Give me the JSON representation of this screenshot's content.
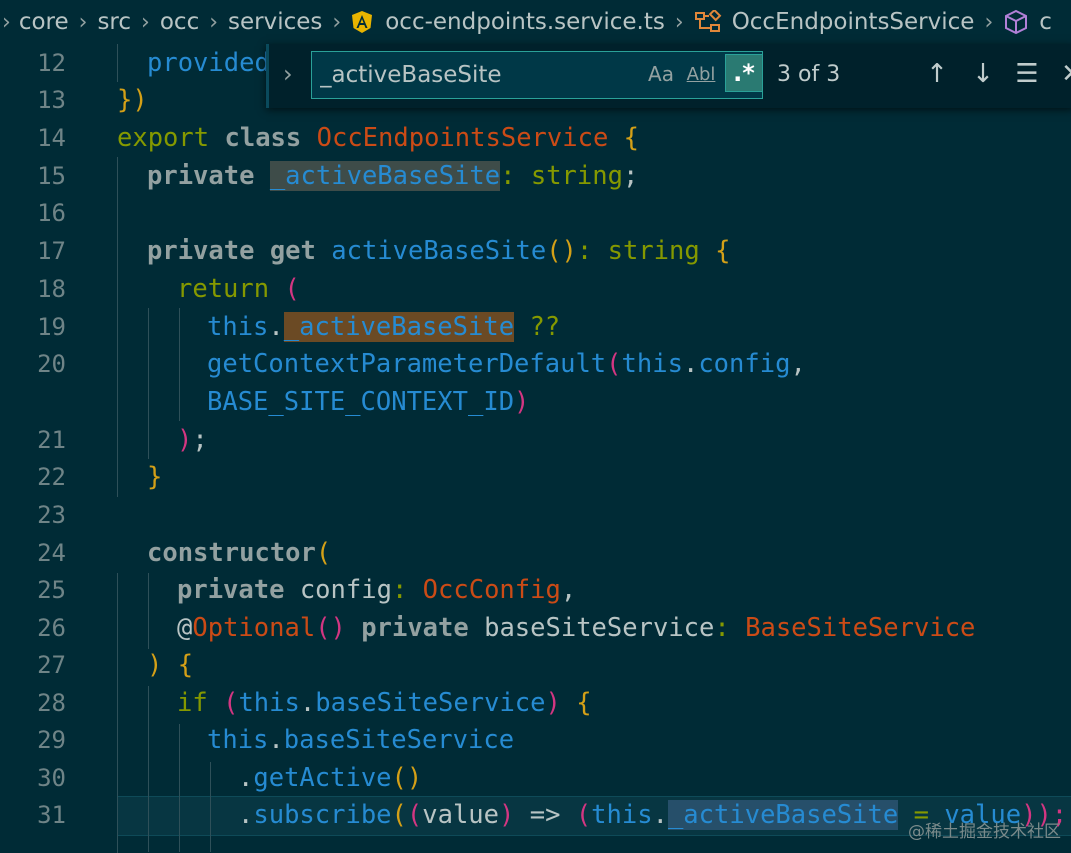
{
  "breadcrumb": {
    "items": [
      "core",
      "src",
      "occ",
      "services",
      "occ-endpoints.service.ts",
      "OccEndpointsService",
      "c"
    ],
    "icons": [
      "angular-icon",
      "class-icon",
      "method-cube-icon"
    ]
  },
  "find": {
    "query": "_activeBaseSite",
    "case_label": "Aa",
    "word_label": "Abl",
    "regex_label": ".*",
    "count": "3 of 3",
    "regex_enabled": true
  },
  "line_numbers": [
    "12",
    "13",
    "14",
    "15",
    "16",
    "17",
    "18",
    "19",
    "20",
    "",
    "21",
    "22",
    "23",
    "24",
    "25",
    "26",
    "27",
    "28",
    "29",
    "30",
    "31"
  ],
  "code": {
    "l12": "provided",
    "l13": "})",
    "l14_kw": "export",
    "l14_cls_kw": "class",
    "l14_name": "OccEndpointsService",
    "l14_brace": "{",
    "l15_kw": "private",
    "l15_id": "_activeBaseSite",
    "l15_colon": ":",
    "l15_type": "string",
    "l15_semi": ";",
    "l17_kw": "private get",
    "l17_fn": "activeBaseSite",
    "l17_paren": "()",
    "l17_colon": ":",
    "l17_type": "string",
    "l17_brace": "{",
    "l18_kw": "return",
    "l18_paren": "(",
    "l19_this": "this",
    "l19_dot": ".",
    "l19_id": "_activeBaseSite",
    "l19_op": "??",
    "l20_fn": "getContextParameterDefault",
    "l20_paren": "(",
    "l20_this": "this",
    "l20_dot": ".",
    "l20_prop": "config",
    "l20_comma": ",",
    "l20b_const": "BASE_SITE_CONTEXT_ID",
    "l20b_paren": ")",
    "l21_paren": ")",
    "l21_semi": ";",
    "l22": "}",
    "l24_kw": "constructor",
    "l24_paren": "(",
    "l25_kw": "private",
    "l25_id": "config",
    "l25_colon": ":",
    "l25_type": "OccConfig",
    "l25_comma": ",",
    "l26_at": "@",
    "l26_dec": "Optional",
    "l26_paren": "()",
    "l26_kw": "private",
    "l26_id": "baseSiteService",
    "l26_colon": ":",
    "l26_type": "BaseSiteService",
    "l27_paren": ")",
    "l27_brace": "{",
    "l28_kw": "if",
    "l28_paren": "(",
    "l28_this": "this",
    "l28_dot": ".",
    "l28_prop": "baseSiteService",
    "l28_close": ")",
    "l28_brace": "{",
    "l29_this": "this",
    "l29_dot": ".",
    "l29_prop": "baseSiteService",
    "l30_dot": ".",
    "l30_fn": "getActive",
    "l30_paren": "()",
    "l31_dot": ".",
    "l31_fn": "subscribe",
    "l31_p1": "(",
    "l31_p2": "(",
    "l31_arg": "value",
    "l31_p3": ")",
    "l31_arrow": "=>",
    "l31_p4": "(",
    "l31_this": "this",
    "l31_dot2": ".",
    "l31_id": "_activeBaseSite",
    "l31_eq": "=",
    "l31_val": "value",
    "l31_end": "));"
  },
  "watermark": "@稀土掘金技术社区",
  "colors": {
    "background": "#002b36",
    "keyword": "#859900",
    "function": "#268bd2",
    "class": "#cb4b16",
    "accent": "#2aa198"
  }
}
